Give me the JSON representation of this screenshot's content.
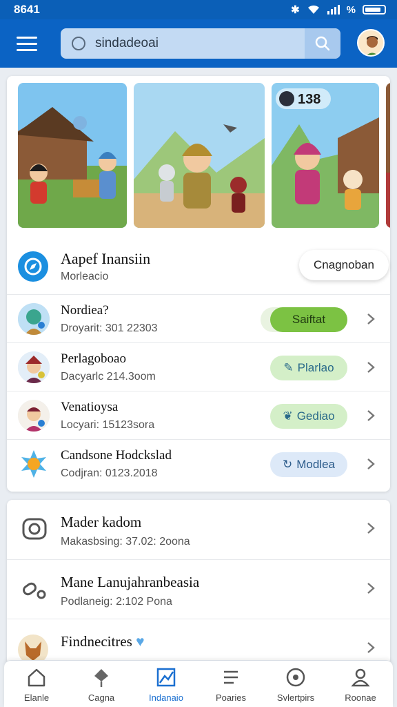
{
  "status": {
    "time": "8641",
    "battery_icon": "battery-icon"
  },
  "search": {
    "value": "sindadeoai",
    "placeholder": "sindadeoai"
  },
  "carousel": {
    "badge_count": "138"
  },
  "featured": {
    "title": "Aapef Inansiin",
    "subtitle": "Morleacio",
    "button_label": "Cnagnoban"
  },
  "list": [
    {
      "title": "Nordiea?",
      "subtitle": "Droyarit: 301 22303",
      "action": "Saiftat",
      "action_style": "solid"
    },
    {
      "title": "Perlagoboao",
      "subtitle": "Dacyarlc 214.3oom",
      "action": "Plarlao",
      "action_style": "soft-green"
    },
    {
      "title": "Venatioysa",
      "subtitle": "Locyari: 15123sora",
      "action": "Gediao",
      "action_style": "soft-green"
    },
    {
      "title": "Candsone Hodckslad",
      "subtitle": "Codjran: 0123.2018",
      "action": "Modlea",
      "action_style": "soft-blue"
    }
  ],
  "list2": [
    {
      "title": "Mader kadom",
      "subtitle": "Makasbsing: 37.02: 2oona"
    },
    {
      "title": "Mane Lanujahranbeasia",
      "subtitle": "Podlaneig: 2:102 Pona"
    },
    {
      "title": "Findnecitres",
      "subtitle": ""
    }
  ],
  "nav": [
    {
      "label": "Elanle",
      "icon": "home-icon"
    },
    {
      "label": "Cagna",
      "icon": "pin-icon"
    },
    {
      "label": "Indanaio",
      "icon": "chart-icon"
    },
    {
      "label": "Poaries",
      "icon": "list-icon"
    },
    {
      "label": "Svlertpirs",
      "icon": "target-icon"
    },
    {
      "label": "Roonae",
      "icon": "user-icon"
    }
  ],
  "colors": {
    "appbar": "#0b63c4",
    "accent": "#1a6fd0",
    "solid_pill": "#7cc243",
    "soft_green": "#d4efc8",
    "soft_blue": "#dde9f8"
  }
}
